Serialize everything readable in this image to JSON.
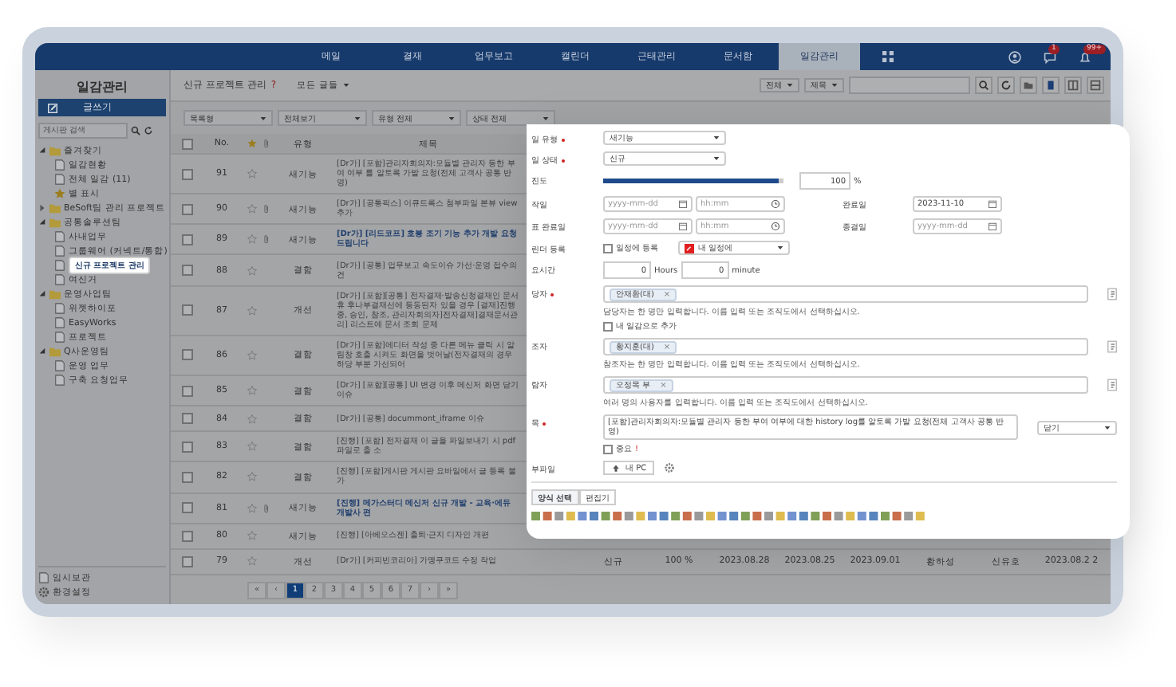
{
  "nav": {
    "items": [
      {
        "label": "메일",
        "selected": false
      },
      {
        "label": "결재",
        "selected": false
      },
      {
        "label": "업무보고",
        "selected": false
      },
      {
        "label": "캘린더",
        "selected": false
      },
      {
        "label": "근태관리",
        "selected": false
      },
      {
        "label": "문서함",
        "selected": false
      },
      {
        "label": "일감관리",
        "selected": true
      }
    ],
    "badges": [
      "1",
      "99+"
    ]
  },
  "sidebar": {
    "title": "일감관리",
    "write_button": "글쓰기",
    "search": {
      "placeholder": "게시판 검색"
    },
    "tree": [
      {
        "label": "즐겨찾기",
        "kind": "folder",
        "expanded": true,
        "selected": false,
        "children": [
          {
            "label": "일감현황",
            "kind": "board",
            "selected": false
          },
          {
            "label": "전체 일감 (11)",
            "kind": "board",
            "selected": false
          },
          {
            "label": "별 표시",
            "kind": "star",
            "selected": false
          }
        ]
      },
      {
        "label": "BeSoft팀 관리 프로젝트",
        "kind": "folder",
        "expanded": false,
        "selected": false
      },
      {
        "label": "공통솔루션팀",
        "kind": "folder",
        "expanded": true,
        "selected": false,
        "children": [
          {
            "label": "사내업무",
            "kind": "board",
            "selected": false
          },
          {
            "label": "그룹웨어 (커넥트/통합)",
            "kind": "board",
            "selected": false
          },
          {
            "label": "신규 프로젝트 관리",
            "kind": "board",
            "selected": true
          },
          {
            "label": "여신거",
            "kind": "board",
            "selected": false
          }
        ]
      },
      {
        "label": "운영사업팀",
        "kind": "folder",
        "expanded": true,
        "selected": false,
        "children": [
          {
            "label": "위젯하이포",
            "kind": "board",
            "selected": false
          },
          {
            "label": "EasyWorks",
            "kind": "board",
            "selected": false
          },
          {
            "label": "프로젝트",
            "kind": "board",
            "selected": false
          }
        ]
      },
      {
        "label": "Q사운영팀",
        "kind": "folder",
        "expanded": true,
        "selected": false,
        "children": [
          {
            "label": "운영 업무",
            "kind": "board",
            "selected": false
          },
          {
            "label": "구축 요청업무",
            "kind": "board",
            "selected": false
          }
        ]
      }
    ],
    "footer": [
      {
        "label": "임시보관",
        "kind": "board"
      },
      {
        "label": "환경설정",
        "kind": "settings"
      }
    ]
  },
  "header": {
    "title": "신규 프로젝트 관리",
    "help": "?",
    "scope": "모든 글들",
    "search_scope": "전체",
    "search_field": "제목"
  },
  "filters": [
    "목록형",
    "전체보기",
    "유형 전체",
    "상태 전체"
  ],
  "table": {
    "all_checked": false,
    "columns": [
      "No.",
      "유형",
      "제목"
    ],
    "rows": [
      {
        "no": "91",
        "checked": false,
        "type": "새기능",
        "title": "[Dr가] [포함]관리자회의자:모듈별 관리자 등한 부여 여부 를 알토록 가발 요청(전체 고객사 공통 반영)",
        "starred": false,
        "attachment": false,
        "unread": false
      },
      {
        "no": "90",
        "checked": false,
        "type": "새기능",
        "title": "[Dr가] [공통픽스] 이큐드록스 첨부파일 본뷰 view 추가",
        "starred": false,
        "attachment": true,
        "unread": false
      },
      {
        "no": "89",
        "checked": false,
        "type": "새기능",
        "title": "[Dr가] [리드코프] 호봉 조기 기능 추가 개발 요청 드립니다",
        "starred": false,
        "attachment": true,
        "unread": true
      },
      {
        "no": "88",
        "checked": false,
        "type": "결함",
        "title": "[Dr가] [공통] 업무보고 속도이슈 가선·운영 접수의 건",
        "starred": false,
        "attachment": false,
        "unread": false
      },
      {
        "no": "87",
        "checked": false,
        "type": "개선",
        "title": "[Dr가] [포함][공통] 전자결재·발송신청결재인 문서 휴 후나부결재선에 등동된자 있을 경우 [결재]진행중, 승인, 참조, 관리자회의자]전자결재]결재문서관리] 리스트에 문서 조회 문제",
        "starred": false,
        "attachment": false,
        "unread": false
      },
      {
        "no": "86",
        "checked": false,
        "type": "결함",
        "title": "[Dr가] [포함]에디터 작성 중 다른 메뉴 클릭 시 알림창 호출 시켜도 화면을 벗어날(전자결재의 경우 하당 부분 가선되어",
        "starred": false,
        "attachment": false,
        "unread": false
      },
      {
        "no": "85",
        "checked": false,
        "type": "결함",
        "title": "[Dr가] [포함][공통] UI 변경 이후 메신저 화면 닫기 이슈",
        "starred": false,
        "attachment": false,
        "unread": false
      },
      {
        "no": "84",
        "checked": false,
        "type": "결함",
        "title": "[Dr가] [공통] docummont_iframe 이슈",
        "starred": false,
        "attachment": false,
        "unread": false
      },
      {
        "no": "83",
        "checked": false,
        "type": "결함",
        "title": "[진행] [포함] 전자결재 이 글을 파일보내기 시 pdf 파일로 출 소",
        "starred": false,
        "attachment": false,
        "unread": false
      },
      {
        "no": "82",
        "checked": false,
        "type": "결함",
        "title": "[진행] [포함]게시판 게시판 요바일에서 글 등록 불가",
        "starred": false,
        "attachment": false,
        "unread": false
      },
      {
        "no": "81",
        "checked": false,
        "type": "새기능",
        "title": "[진행] 메가스터디 메신저 신규 개발 - 교육·에듀 개발사 편",
        "starred": false,
        "attachment": true,
        "unread": true
      },
      {
        "no": "80",
        "checked": false,
        "type": "새기능",
        "title": "[진행] [아베오스젠] 출퇴·근지 디자인 개편",
        "starred": false,
        "attachment": false,
        "unread": false
      },
      {
        "no": "79",
        "checked": false,
        "type": "개선",
        "title": "[Dr가] [커피빈코리아] 가맹쿠코드 수정 작업",
        "starred": false,
        "attachment": false,
        "unread": false,
        "cells": [
          "신규",
          "100 %",
          "2023.08.28",
          "2023.08.25",
          "2023.09.01",
          "황하성",
          "신유호",
          "2023.08.2 2"
        ]
      }
    ]
  },
  "pagination": {
    "first": "«",
    "prev": "‹",
    "pages": [
      {
        "label": "1",
        "selected": true
      },
      {
        "label": "2",
        "selected": false
      },
      {
        "label": "3",
        "selected": false
      },
      {
        "label": "4",
        "selected": false
      },
      {
        "label": "5",
        "selected": false
      },
      {
        "label": "6",
        "selected": false
      },
      {
        "label": "7",
        "selected": false
      }
    ],
    "next": "›",
    "last": "»"
  },
  "form": {
    "fields": [
      {
        "kind": "select",
        "label": "일 유형",
        "required": true,
        "value": "새기능"
      },
      {
        "kind": "select",
        "label": "일 상태",
        "required": true,
        "value": "신규"
      },
      {
        "kind": "progress",
        "label": "진도",
        "level": 1,
        "value": "100",
        "unit": "%"
      },
      {
        "kind": "dates",
        "label": "작일",
        "date_placeholder": "yyyy-mm-dd",
        "time_placeholder": "hh:mm",
        "right_label": "완료일",
        "right_value": "2023-11-10"
      },
      {
        "kind": "dates",
        "label": "표 완료일",
        "date_placeholder": "yyyy-mm-dd",
        "time_placeholder": "hh:mm",
        "right_label": "종결일",
        "right_placeholder": "yyyy-mm-dd"
      },
      {
        "kind": "calendar",
        "label": "린더 등록",
        "checkbox": {
          "label": "일정에 등록",
          "checked": false
        },
        "value": "내 일정에"
      },
      {
        "kind": "duration",
        "label": "요시간",
        "hours": "0",
        "hours_unit": "Hours",
        "minutes": "0",
        "minutes_unit": "minute"
      },
      {
        "kind": "people",
        "label": "당자",
        "required": true,
        "chip": "안재환(대)",
        "remove": "×",
        "hint": "담당자는 한 명만 입력합니다. 이름 입력 또는 조직도에서 선택하십시오.",
        "checkbox": {
          "label": "내 일감으로 추가",
          "checked": false
        }
      },
      {
        "kind": "people",
        "label": "조자",
        "required": false,
        "chip": "황지훈(대)",
        "remove": "×",
        "hint": "참조자는 한 명만 입력합니다. 이름 입력 또는 조직도에서 선택하십시오."
      },
      {
        "kind": "people",
        "label": "람자",
        "required": false,
        "chip": "오정목 부",
        "remove": "×",
        "hint": "여러 명의 사용자를 입력합니다. 이름 입력 또는 조직도에서 선택하십시오."
      },
      {
        "kind": "title",
        "label": "목",
        "required": true,
        "value": "[포함]관리자회의자:모듈별 관리자 등한 부여 여부에 대한 history log를 알토록 가발 요청(전체 고객사 공통 반영)",
        "select": "닫기",
        "checkbox": {
          "label": "중요",
          "checked": false
        },
        "mark": "!"
      },
      {
        "kind": "attach",
        "label": "부파일",
        "button": "내 PC"
      }
    ],
    "tabs": [
      {
        "label": "양식 선택",
        "selected": true
      },
      {
        "label": "편집기",
        "selected": false
      }
    ]
  }
}
